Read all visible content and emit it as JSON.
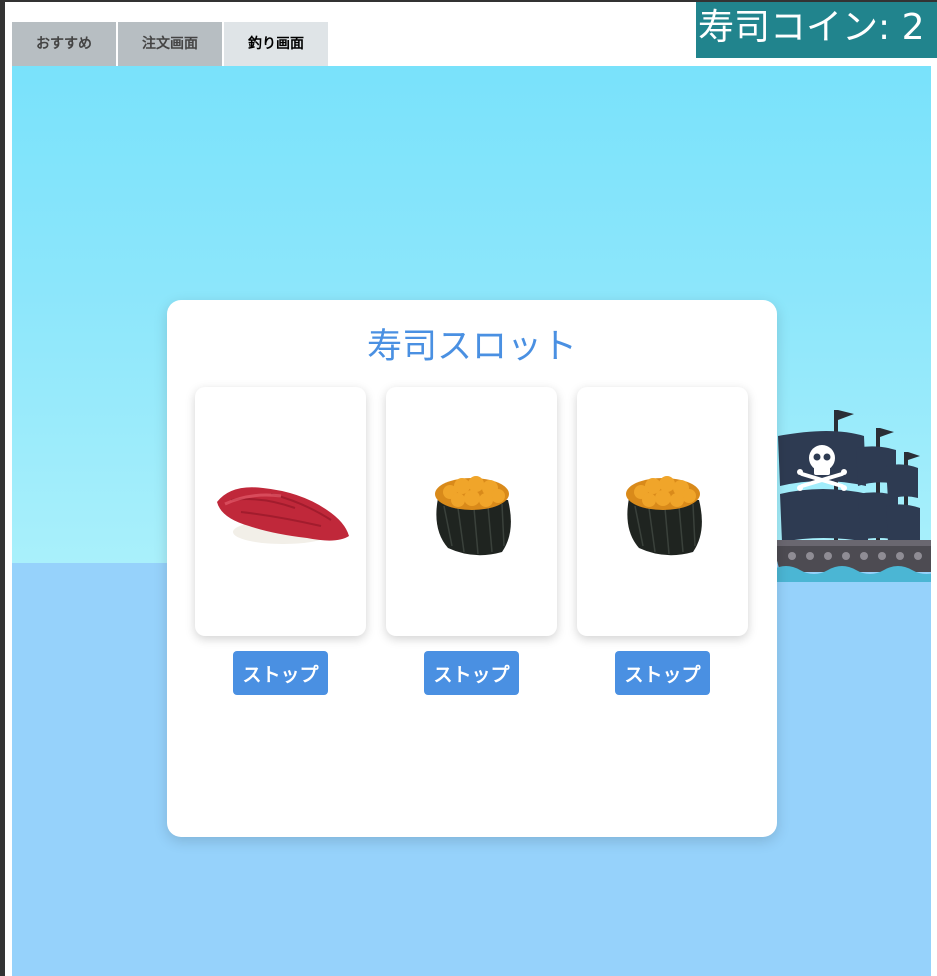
{
  "tabs": [
    {
      "label": "おすすめ",
      "active": false
    },
    {
      "label": "注文画面",
      "active": false
    },
    {
      "label": "釣り画面",
      "active": true
    }
  ],
  "coin_display": "寿司コイン: 2",
  "slot": {
    "title": "寿司スロット",
    "reels": [
      {
        "item": "tuna-nigiri"
      },
      {
        "item": "uni-gunkan"
      },
      {
        "item": "uni-gunkan"
      }
    ],
    "stop_label": "ストップ"
  },
  "colors": {
    "accent": "#4a90e2",
    "coin_bg": "#21848d",
    "sky": "#79e2fb",
    "sea": "#96d2fb"
  },
  "icons": [
    "pirate-ship-icon",
    "skull-flag-icon",
    "tuna-nigiri-icon",
    "uni-gunkan-icon"
  ]
}
